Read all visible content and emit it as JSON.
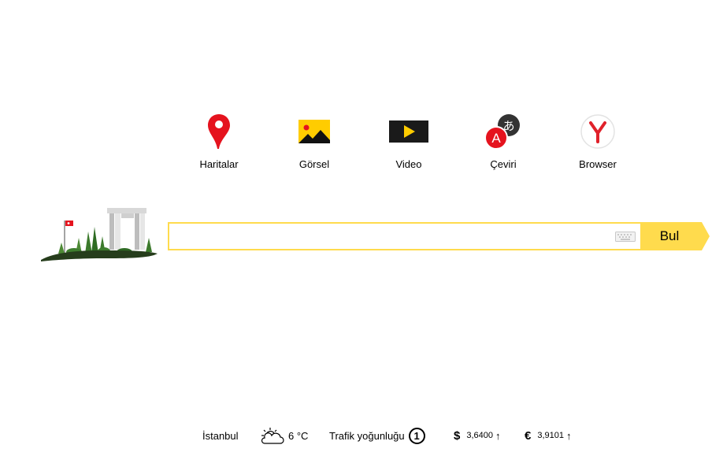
{
  "services": [
    {
      "label": "Haritalar",
      "icon": "map-pin-icon"
    },
    {
      "label": "Görsel",
      "icon": "image-icon"
    },
    {
      "label": "Video",
      "icon": "video-play-icon"
    },
    {
      "label": "Çeviri",
      "icon": "translate-icon"
    },
    {
      "label": "Browser",
      "icon": "yandex-browser-icon"
    }
  ],
  "search": {
    "value": "",
    "placeholder": "",
    "button_label": "Bul",
    "keyboard_icon": "keyboard-icon"
  },
  "footer": {
    "city": "İstanbul",
    "weather": {
      "temperature": "6 °C",
      "icon": "partly-cloudy-icon"
    },
    "traffic": {
      "label": "Trafik yoğunluğu",
      "score": "1"
    },
    "usd": {
      "symbol": "$",
      "value": "3,6400",
      "trend": "↑"
    },
    "eur": {
      "symbol": "€",
      "value": "3,9101",
      "trend": "↑"
    }
  },
  "colors": {
    "accent_yellow": "#ffdb4d",
    "map_red": "#e5131e",
    "yandex_red": "#e0212a"
  }
}
